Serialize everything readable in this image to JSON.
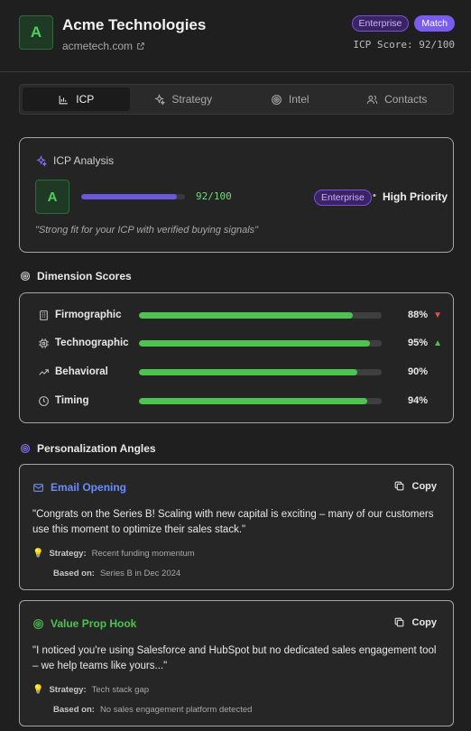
{
  "header": {
    "logo_letter": "A",
    "company_name": "Acme Technologies",
    "domain": "acmetech.com",
    "badge_enterprise": "Enterprise",
    "badge_match": "Match",
    "icp_score_text": "ICP Score: 92/100"
  },
  "tabs": [
    {
      "label": "ICP",
      "active": true,
      "icon": "bar-chart-icon"
    },
    {
      "label": "Strategy",
      "active": false,
      "icon": "sparkles-icon"
    },
    {
      "label": "Intel",
      "active": false,
      "icon": "target-icon"
    },
    {
      "label": "Contacts",
      "active": false,
      "icon": "users-icon"
    }
  ],
  "icp_analysis": {
    "title": "ICP Analysis",
    "grade": "A",
    "score": 92,
    "score_text": "92/100",
    "segment": "Enterprise",
    "separator": "•",
    "priority": "High Priority",
    "quote": "\"Strong fit for your ICP with verified buying signals\""
  },
  "dimensions": {
    "title": "Dimension Scores",
    "items": [
      {
        "label": "Firmographic",
        "value": 88,
        "pct": "88%",
        "trend": "down",
        "trend_glyph": "▼",
        "icon": "building-icon"
      },
      {
        "label": "Technographic",
        "value": 95,
        "pct": "95%",
        "trend": "up",
        "trend_glyph": "▲",
        "icon": "chip-icon"
      },
      {
        "label": "Behavioral",
        "value": 90,
        "pct": "90%",
        "trend": "",
        "trend_glyph": "",
        "icon": "trending-icon"
      },
      {
        "label": "Timing",
        "value": 94,
        "pct": "94%",
        "trend": "",
        "trend_glyph": "",
        "icon": "clock-icon"
      }
    ]
  },
  "personalization": {
    "title": "Personalization Angles",
    "copy_label": "Copy",
    "strategy_label": "Strategy:",
    "based_label": "Based on:",
    "angles": [
      {
        "title": "Email Opening",
        "text": "\"Congrats on the Series B! Scaling with new capital is exciting – many of our customers use this moment to optimize their sales stack.\"",
        "strategy": "Recent funding momentum",
        "based_on": "Series B in Dec 2024"
      },
      {
        "title": "Value Prop Hook",
        "text": "\"I noticed you're using Salesforce and HubSpot but no dedicated sales engagement tool – we help teams like yours...\"",
        "strategy": "Tech stack gap",
        "based_on": "No sales engagement platform detected"
      }
    ]
  },
  "colors": {
    "accent_purple": "#7b5cf0",
    "success_green": "#4cc44f",
    "email_blue": "#6b8cff",
    "trend_down_red": "#e05252"
  }
}
